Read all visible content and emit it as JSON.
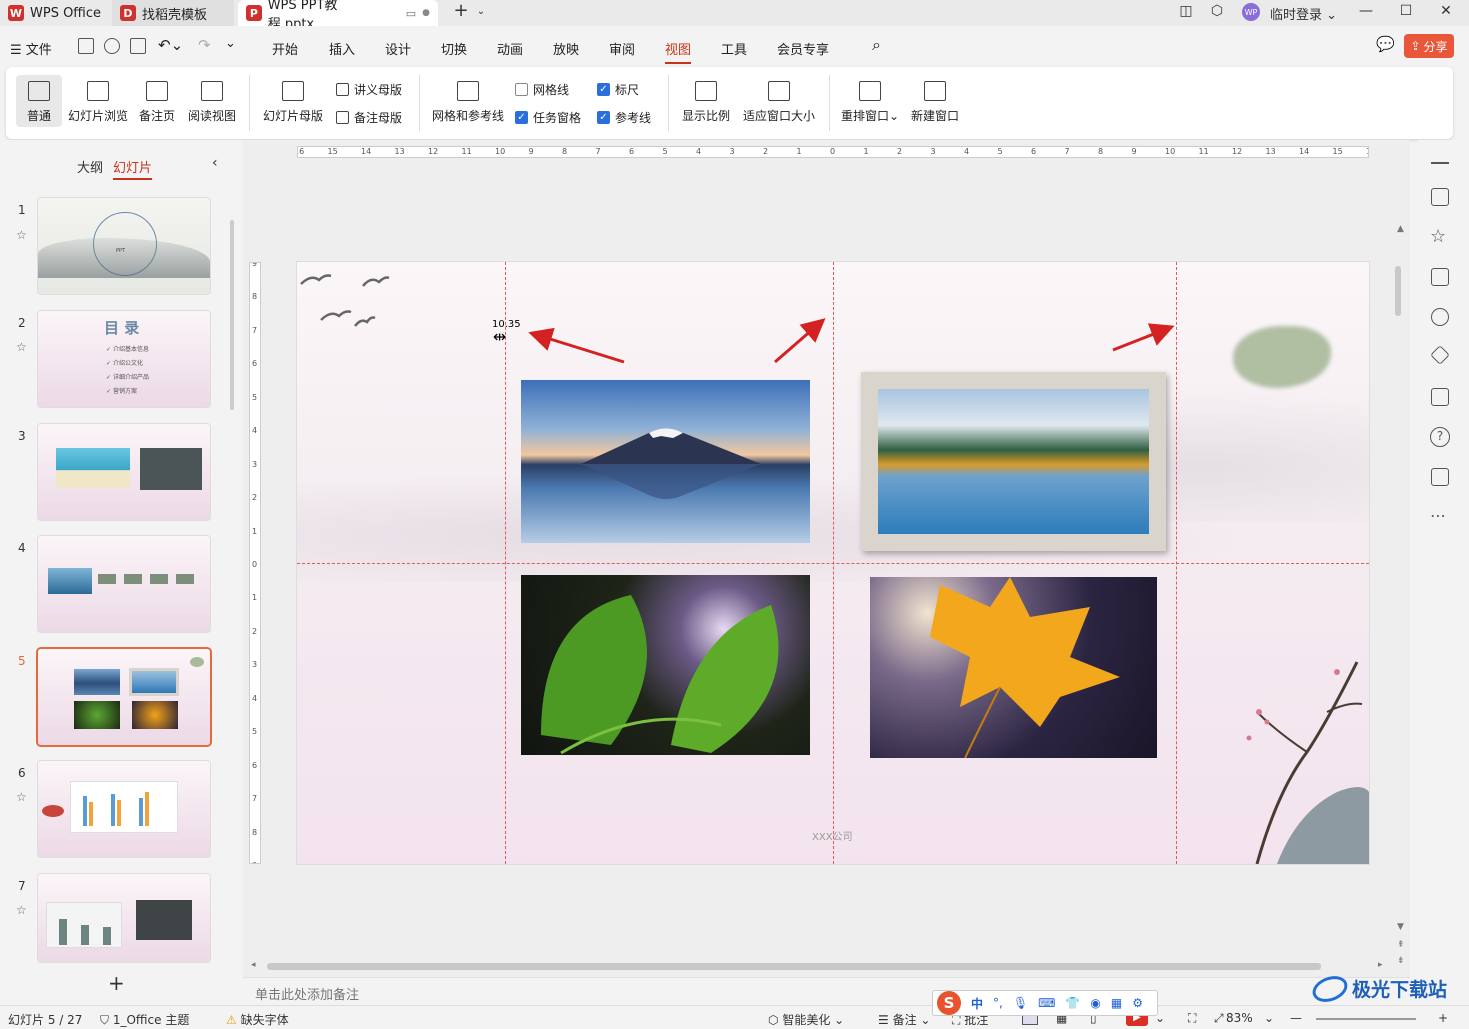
{
  "tabs": [
    {
      "label": "WPS Office",
      "logo": "W",
      "color": "#d0312d"
    },
    {
      "label": "找稻壳模板",
      "logo": "D",
      "color": "#d0312d"
    },
    {
      "label": "WPS PPT教程.pptx",
      "logo": "P",
      "color": "#d0312d"
    }
  ],
  "user": {
    "label": "临时登录",
    "avatar": "WP"
  },
  "menu": {
    "file": "文件",
    "items": [
      "开始",
      "插入",
      "设计",
      "切换",
      "动画",
      "放映",
      "审阅",
      "视图",
      "工具",
      "会员专享"
    ],
    "active": "视图",
    "share": "分享"
  },
  "ribbon": {
    "normal": "普通",
    "browse": "幻灯片浏览",
    "notes_page": "备注页",
    "reading": "阅读视图",
    "slide_master": "幻灯片母版",
    "handout_master": "讲义母版",
    "notes_master": "备注母版",
    "grid_guides": "网格和参考线",
    "gridlines": {
      "label": "网格线",
      "checked": false
    },
    "task_pane": {
      "label": "任务窗格",
      "checked": true
    },
    "ruler": {
      "label": "标尺",
      "checked": true
    },
    "guides": {
      "label": "参考线",
      "checked": true
    },
    "zoom": "显示比例",
    "fit": "适应窗口大小",
    "arrange": "重排窗口",
    "new_window": "新建窗口"
  },
  "panel": {
    "outline": "大纲",
    "slides": "幻灯片",
    "active": "幻灯片"
  },
  "thumbs": [
    {
      "n": "1",
      "star": true,
      "title": "PPT"
    },
    {
      "n": "2",
      "star": true,
      "title": "目 录",
      "items": [
        "介绍基本信息",
        "介绍公文化",
        "详细介绍产品",
        "营销方案"
      ]
    },
    {
      "n": "3",
      "star": false
    },
    {
      "n": "4",
      "star": false
    },
    {
      "n": "5",
      "star": false,
      "selected": true
    },
    {
      "n": "6",
      "star": true
    },
    {
      "n": "7",
      "star": true
    }
  ],
  "ruler": {
    "h_ticks": [
      "16",
      "15",
      "14",
      "13",
      "12",
      "11",
      "10",
      "9",
      "8",
      "7",
      "6",
      "5",
      "4",
      "3",
      "2",
      "1",
      "0",
      "1",
      "2",
      "3",
      "4",
      "5",
      "6",
      "7",
      "8",
      "9",
      "10",
      "11",
      "12",
      "13",
      "14",
      "15",
      "16"
    ],
    "v_ticks": [
      "9",
      "8",
      "7",
      "6",
      "5",
      "4",
      "3",
      "2",
      "1",
      "0",
      "1",
      "2",
      "3",
      "4",
      "5",
      "6",
      "7",
      "8",
      "9"
    ]
  },
  "slide": {
    "guide_readout": "10.35",
    "footer": "XXX公司"
  },
  "notes_placeholder": "单击此处添加备注",
  "status": {
    "slide": "幻灯片 5 / 27",
    "theme": "1_Office 主题",
    "missing_font": "缺失字体",
    "beautify": "智能美化",
    "notes": "备注",
    "comment": "批注",
    "zoom": "83%"
  },
  "ime": [
    "中",
    "°,",
    "麦",
    "键",
    "衣",
    "游",
    "格",
    "设"
  ],
  "watermark": "极光下载站",
  "colors": {
    "accent": "#c7341c",
    "guide": "#e05a5a",
    "checkbox": "#2a6fdb"
  }
}
